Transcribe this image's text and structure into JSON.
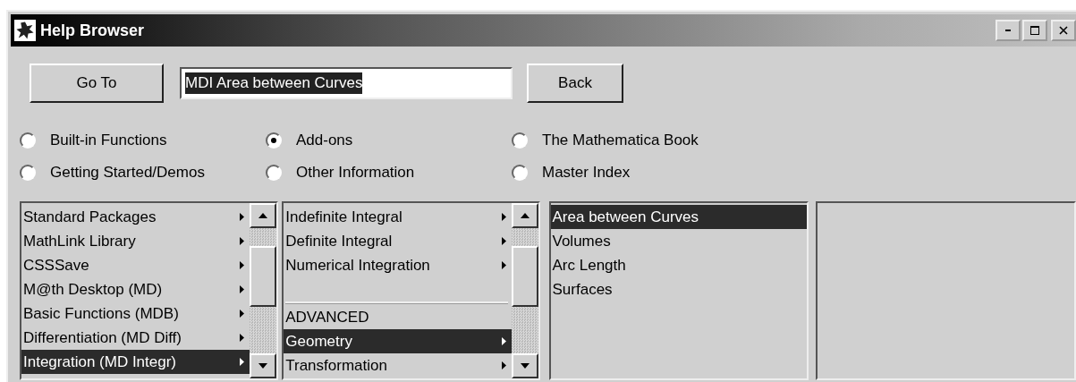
{
  "window": {
    "title": "Help Browser"
  },
  "toolbar": {
    "goto_button": "Go To",
    "search": {
      "value": "MDI Area between Curves",
      "text_selected": true
    },
    "back_button": "Back"
  },
  "categories": [
    {
      "label": "Built-in Functions",
      "selected": false
    },
    {
      "label": "Add-ons",
      "selected": true
    },
    {
      "label": "The Mathematica Book",
      "selected": false
    },
    {
      "label": "Getting Started/Demos",
      "selected": false
    },
    {
      "label": "Other Information",
      "selected": false
    },
    {
      "label": "Master Index",
      "selected": false
    }
  ],
  "lists": [
    {
      "scrollbar": true,
      "items": [
        {
          "kind": "item",
          "label": "Standard Packages",
          "submenu": true,
          "selected": false
        },
        {
          "kind": "item",
          "label": "MathLink Library",
          "submenu": true,
          "selected": false
        },
        {
          "kind": "item",
          "label": "CSSSave",
          "submenu": true,
          "selected": false
        },
        {
          "kind": "item",
          "label": "M@th Desktop  (MD)",
          "submenu": true,
          "selected": false
        },
        {
          "kind": "item",
          "label": "Basic Functions (MDB)",
          "submenu": true,
          "selected": false
        },
        {
          "kind": "item",
          "label": "Differentiation (MD Diff)",
          "submenu": true,
          "selected": false
        },
        {
          "kind": "item",
          "label": "Integration (MD Integr)",
          "submenu": true,
          "selected": true
        }
      ]
    },
    {
      "scrollbar": true,
      "items": [
        {
          "kind": "item",
          "label": "Indefinite Integral",
          "submenu": true,
          "selected": false
        },
        {
          "kind": "item",
          "label": "Definite Integral",
          "submenu": true,
          "selected": false
        },
        {
          "kind": "item",
          "label": "Numerical Integration",
          "submenu": true,
          "selected": false
        },
        {
          "kind": "separator"
        },
        {
          "kind": "item",
          "label": "ADVANCED",
          "submenu": false,
          "selected": false
        },
        {
          "kind": "item",
          "label": "Geometry",
          "submenu": true,
          "selected": true
        },
        {
          "kind": "item",
          "label": "Transformation",
          "submenu": true,
          "selected": false
        }
      ]
    },
    {
      "scrollbar": false,
      "items": [
        {
          "kind": "item",
          "label": "Area between Curves",
          "submenu": false,
          "selected": true
        },
        {
          "kind": "item",
          "label": "Volumes",
          "submenu": false,
          "selected": false
        },
        {
          "kind": "item",
          "label": "Arc Length",
          "submenu": false,
          "selected": false
        },
        {
          "kind": "item",
          "label": "Surfaces",
          "submenu": false,
          "selected": false
        }
      ]
    },
    {
      "scrollbar": false
    }
  ]
}
